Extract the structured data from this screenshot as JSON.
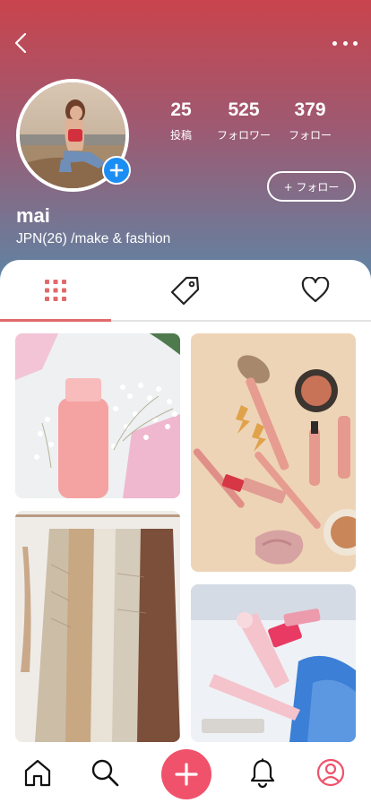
{
  "profile": {
    "username": "mai",
    "bio": "JPN(26) /make & fashion",
    "follow_label": "+ フォロー"
  },
  "stats": [
    {
      "count": "25",
      "label": "投稿"
    },
    {
      "count": "525",
      "label": "フォロワー"
    },
    {
      "count": "379",
      "label": "フォロー"
    }
  ],
  "tabs": {
    "active": "posts",
    "items": [
      "grid-icon",
      "tag-icon",
      "heart-icon"
    ]
  },
  "nav": {
    "items": [
      "home-icon",
      "search-icon",
      "plus-icon",
      "bell-icon",
      "profile-icon"
    ],
    "active": "profile"
  },
  "colors": {
    "accent": "#f0526b",
    "tab_active": "#e06a6a",
    "avatar_badge": "#1b8ef3"
  }
}
